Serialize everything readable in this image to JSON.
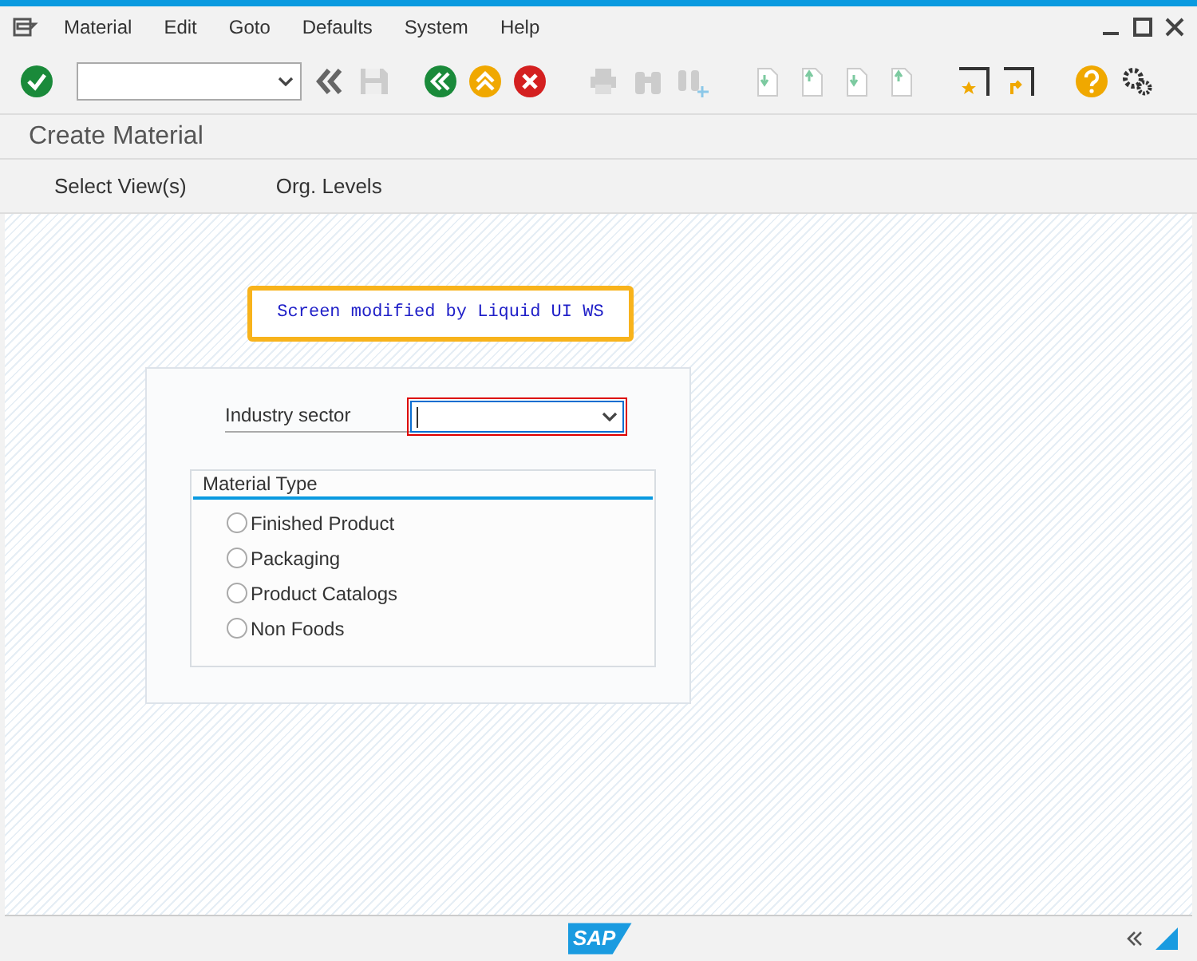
{
  "menu": [
    "Material",
    "Edit",
    "Goto",
    "Defaults",
    "System",
    "Help"
  ],
  "title": "Create Material",
  "app_toolbar": [
    "Select View(s)",
    "Org. Levels"
  ],
  "notice": "Screen modified by Liquid UI WS",
  "industry_sector": {
    "label": "Industry sector"
  },
  "material_type": {
    "title": "Material Type",
    "options": [
      {
        "label": "Finished Product",
        "selected": false
      },
      {
        "label": "Packaging",
        "selected": false
      },
      {
        "label": "Product Catalogs",
        "selected": false
      },
      {
        "label": "Non Foods",
        "selected": false
      }
    ]
  },
  "footer": {
    "logo": "SAP"
  }
}
